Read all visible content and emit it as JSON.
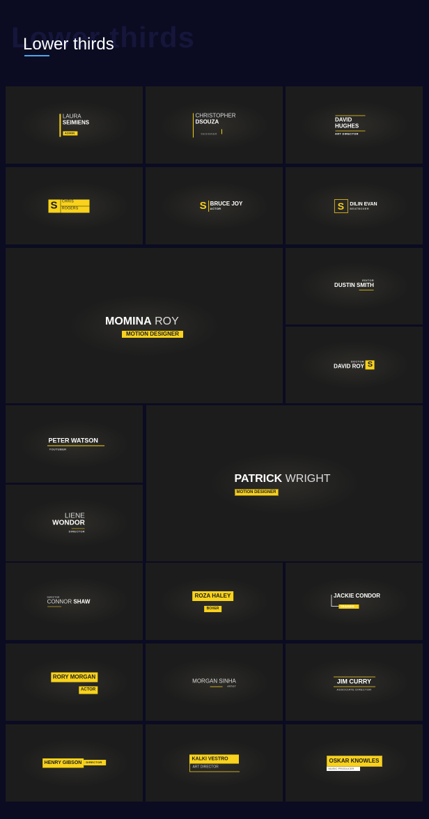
{
  "header": {
    "ghost_title": "Lower thirds",
    "title": "Lower thirds"
  },
  "colors": {
    "page_background": "#0b0b22",
    "tile_background": "#1c1c1c",
    "accent_yellow": "#f8d21c",
    "underline_blue": "#4aa8ec",
    "text_white": "#ffffff"
  },
  "tiles": [
    {
      "first": "LAURA",
      "last": "SEIMIENS",
      "role": "ADMIN"
    },
    {
      "first": "CHRISTOPHER",
      "last": "DSOUZA",
      "role": "DESIGNER"
    },
    {
      "first": "DAVID",
      "last": "HUGHES",
      "role": "ART DIRECTOR"
    },
    {
      "badge": "S",
      "first": "CHRIS",
      "last": "ROGERS"
    },
    {
      "badge": "S",
      "name": "BRUCE JOY",
      "role": "ACTOR"
    },
    {
      "badge": "S",
      "name": "DILIN EVAN",
      "role": "BEATBOXER"
    },
    {
      "first": "MOMINA",
      "last": "ROY",
      "role": "MOTION DESIGNER"
    },
    {
      "name": "DUSTIN SMITH",
      "role": "EDITOR"
    },
    {
      "name": "DAVID ROY",
      "role": "DOCTOR",
      "badge": "S"
    },
    {
      "name": "PETER WATSON",
      "role": "YOUTUBER"
    },
    {
      "first": "LIENE",
      "last": "WONDOR",
      "role": "DIRECTOR"
    },
    {
      "first": "PATRICK",
      "last": "WRIGHT",
      "role": "MOTION DESIGNER"
    },
    {
      "first": "CONNOR",
      "last": "SHAW",
      "role": "DIRECTOR"
    },
    {
      "name": "ROZA HALEY",
      "role": "BOXER"
    },
    {
      "name": "JACKIE CONDOR",
      "role": "TRAINER"
    },
    {
      "name": "RORY MORGAN",
      "role": "ACTOR"
    },
    {
      "name": "MORGAN SINHA",
      "role": "ARTIST"
    },
    {
      "name": "JIM CURRY",
      "role": "ASSOCIATE DIRECTOR"
    },
    {
      "name": "HENRY GIBSON",
      "role": "DIRECTOR"
    },
    {
      "name": "KALKI VESTRO",
      "role": "ART DIRECTOR"
    },
    {
      "name": "OSKAR KNOWLES",
      "role": "MUSIC PRODUCER"
    }
  ]
}
